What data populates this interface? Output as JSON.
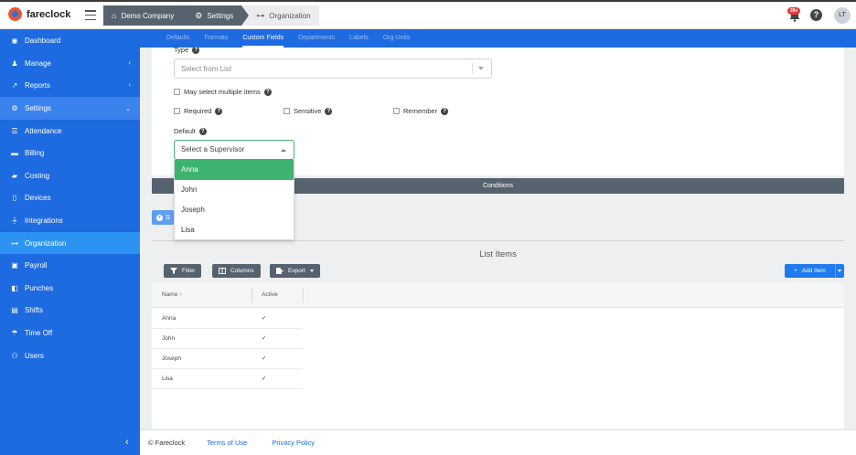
{
  "app": {
    "logo_text": "fareclock"
  },
  "breadcrumb": [
    {
      "label": "Demo Company",
      "icon": "home-icon"
    },
    {
      "label": "Settings",
      "icon": "gear-icon"
    },
    {
      "label": "Organization",
      "icon": "org-chart-icon"
    }
  ],
  "header": {
    "notification_count": "28+",
    "user_initials": "LT"
  },
  "sidebar": {
    "items": [
      {
        "label": "Dashboard",
        "icon": "dashboard-icon",
        "glyph": "◉"
      },
      {
        "label": "Manage",
        "icon": "person-icon",
        "glyph": "👤"
      },
      {
        "label": "Reports",
        "icon": "chart-icon",
        "glyph": "↗"
      },
      {
        "label": "Settings",
        "icon": "gear-icon",
        "glyph": "⚙"
      },
      {
        "label": "Attendance",
        "icon": "list-icon",
        "glyph": "☰"
      },
      {
        "label": "Billing",
        "icon": "card-icon",
        "glyph": "▬"
      },
      {
        "label": "Costing",
        "icon": "folder-icon",
        "glyph": "▰"
      },
      {
        "label": "Devices",
        "icon": "device-icon",
        "glyph": "▯"
      },
      {
        "label": "Integrations",
        "icon": "plug-icon",
        "glyph": "⏚"
      },
      {
        "label": "Organization",
        "icon": "org-chart-icon",
        "glyph": "⊶"
      },
      {
        "label": "Payroll",
        "icon": "money-icon",
        "glyph": "▣"
      },
      {
        "label": "Punches",
        "icon": "car-icon",
        "glyph": "◧"
      },
      {
        "label": "Shifts",
        "icon": "clipboard-icon",
        "glyph": "▤"
      },
      {
        "label": "Time Off",
        "icon": "umbrella-icon",
        "glyph": "☂"
      },
      {
        "label": "Users",
        "icon": "users-icon",
        "glyph": "⚇"
      }
    ]
  },
  "tabs": [
    "Defaults",
    "Formats",
    "Custom Fields",
    "Departments",
    "Labels",
    "Org Units"
  ],
  "form": {
    "type_label": "Type",
    "type_placeholder": "Select from List",
    "multiple_label": "May select multiple items",
    "required_label": "Required",
    "sensitive_label": "Sensitive",
    "remember_label": "Remember",
    "default_label": "Default",
    "default_placeholder": "Select a Supervisor",
    "default_options": [
      "Anna",
      "John",
      "Joseph",
      "Lisa"
    ]
  },
  "conditions_label": "Conditions",
  "save_button_partial": "S",
  "list_items": {
    "title": "List Items",
    "filter_label": "Filter",
    "columns_label": "Columns",
    "export_label": "Export",
    "add_label": "Add Item",
    "col_name": "Name",
    "col_sort_glyph": "↑",
    "col_active": "Active",
    "rows": [
      {
        "name": "Anna",
        "active": "✓"
      },
      {
        "name": "John",
        "active": "✓"
      },
      {
        "name": "Joseph",
        "active": "✓"
      },
      {
        "name": "Lisa",
        "active": "✓"
      }
    ]
  },
  "footer": {
    "copyright": "© Fareclock",
    "terms": "Terms of Use",
    "privacy": "Privacy Policy"
  },
  "colors": {
    "brand_blue": "#1e6ae0",
    "slate": "#56636e",
    "selected_green": "#3cb371"
  }
}
